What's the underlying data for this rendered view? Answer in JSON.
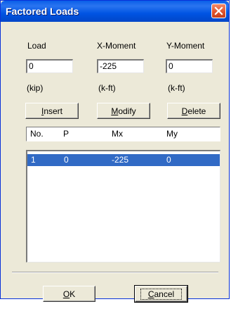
{
  "window": {
    "title": "Factored Loads"
  },
  "fields": [
    {
      "label": "Load",
      "value": "0",
      "unit": "(kip)"
    },
    {
      "label": "X-Moment",
      "value": "-225",
      "unit": "(k-ft)"
    },
    {
      "label": "Y-Moment",
      "value": "0",
      "unit": "(k-ft)"
    }
  ],
  "buttons": {
    "insert": {
      "mnemonic": "I",
      "rest": "nsert"
    },
    "modify": {
      "mnemonic": "M",
      "rest": "odify"
    },
    "delete": {
      "mnemonic": "D",
      "rest": "elete"
    },
    "ok": {
      "mnemonic": "O",
      "rest": "K"
    },
    "cancel": {
      "mnemonic": "C",
      "rest": "ancel"
    }
  },
  "table": {
    "columns": [
      "No.",
      "P",
      "Mx",
      "My"
    ],
    "rows": [
      {
        "no": "1",
        "p": "0",
        "mx": "-225",
        "my": "0",
        "selected": true
      }
    ]
  },
  "icons": {
    "close": "close-x-icon"
  },
  "colors": {
    "titlebar": "#0054e3",
    "selection": "#316ac5",
    "dialog_bg": "#ece9d8"
  }
}
